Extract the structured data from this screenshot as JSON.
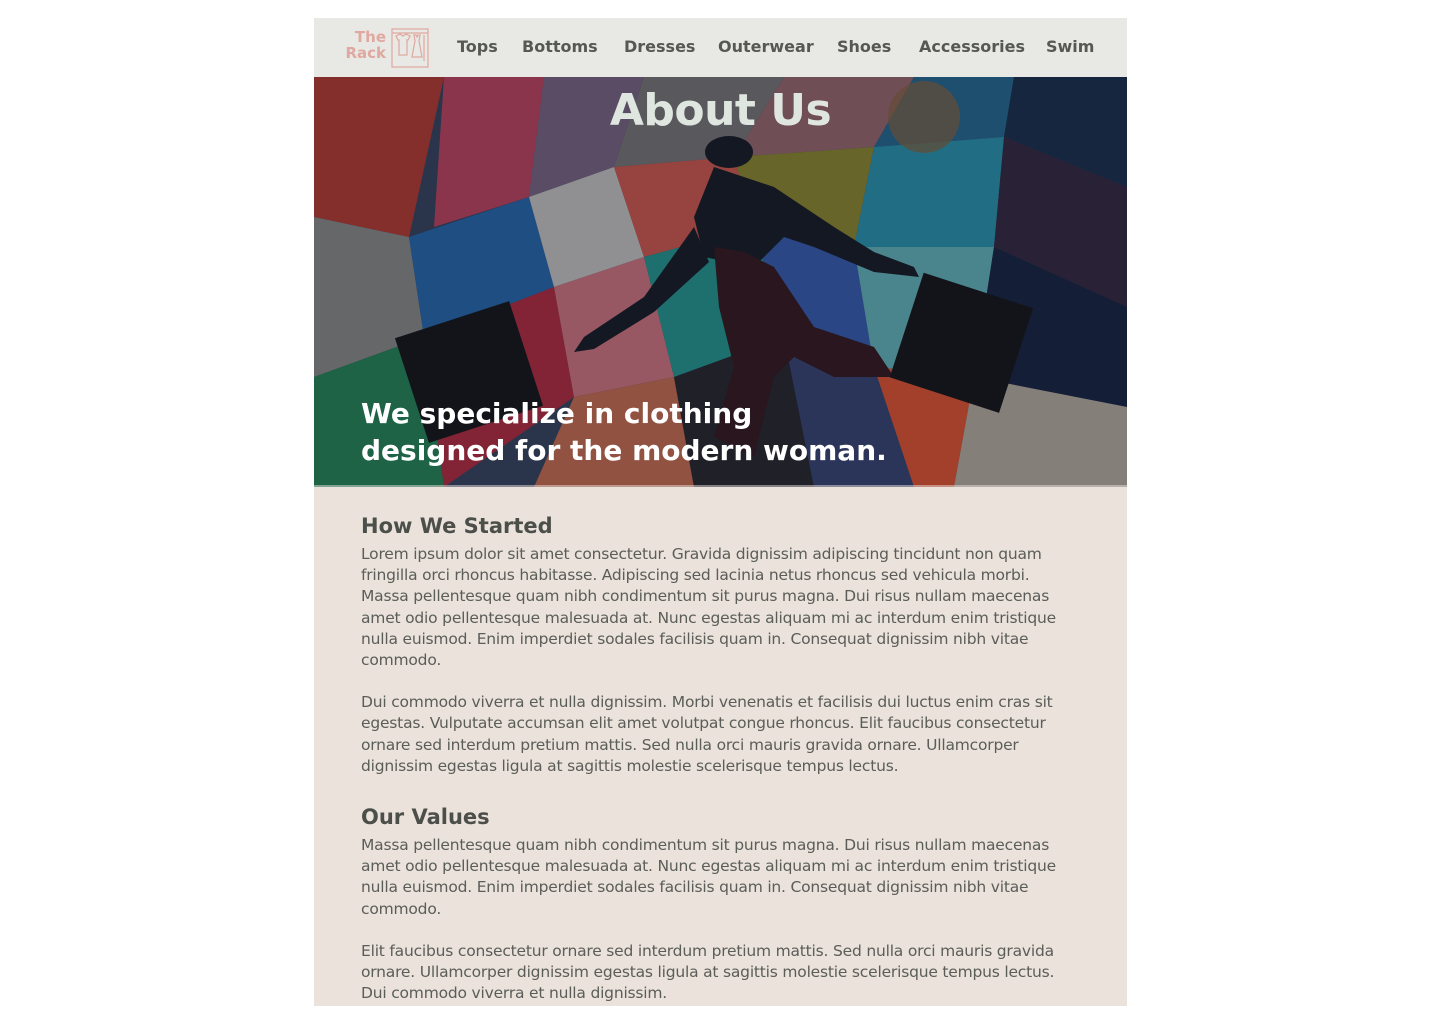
{
  "brand": {
    "logo_line1": "The",
    "logo_line2": "Rack",
    "logo_color": "#e0a8a0"
  },
  "nav": {
    "items": [
      {
        "label": "Tops"
      },
      {
        "label": "Bottoms"
      },
      {
        "label": "Dresses"
      },
      {
        "label": "Outerwear"
      },
      {
        "label": "Shoes"
      },
      {
        "label": "Accessories"
      },
      {
        "label": "Swim"
      }
    ]
  },
  "hero": {
    "title": "About Us",
    "tagline": "We specialize in clothing designed for the modern woman."
  },
  "sections": [
    {
      "heading": "How We Started",
      "paragraphs": [
        "Lorem ipsum dolor sit amet consectetur. Gravida dignissim adipiscing tincidunt non quam fringilla orci rhoncus habitasse. Adipiscing sed lacinia netus rhoncus sed vehicula morbi. Massa pellentesque quam nibh condimentum sit purus magna. Dui risus nullam maecenas amet odio pellentesque malesuada at. Nunc egestas aliquam mi ac interdum enim tristique nulla euismod. Enim imperdiet sodales facilisis quam in. Consequat dignissim nibh vitae commodo.",
        "Dui commodo viverra et nulla dignissim. Morbi venenatis et facilisis dui luctus enim cras sit egestas. Vulputate accumsan elit amet volutpat congue rhoncus. Elit faucibus consectetur ornare sed interdum pretium mattis. Sed nulla orci mauris gravida ornare. Ullamcorper dignissim egestas ligula at sagittis molestie scelerisque tempus lectus."
      ]
    },
    {
      "heading": "Our Values",
      "paragraphs": [
        "Massa pellentesque quam nibh condimentum sit purus magna. Dui risus nullam maecenas amet odio pellentesque malesuada at. Nunc egestas aliquam mi ac interdum enim tristique nulla euismod. Enim imperdiet sodales facilisis quam in. Consequat dignissim nibh vitae commodo.",
        " Elit faucibus consectetur ornare sed interdum pretium mattis. Sed nulla orci mauris gravida ornare. Ullamcorper dignissim egestas ligula at sagittis molestie scelerisque tempus lectus. Dui commodo viverra et nulla dignissim."
      ]
    }
  ],
  "colors": {
    "page_background": "#eae2db",
    "nav_background": "#e8e8e4",
    "nav_text": "#555853",
    "heading_text": "#4c4e4a",
    "body_text": "#5b5d58"
  }
}
